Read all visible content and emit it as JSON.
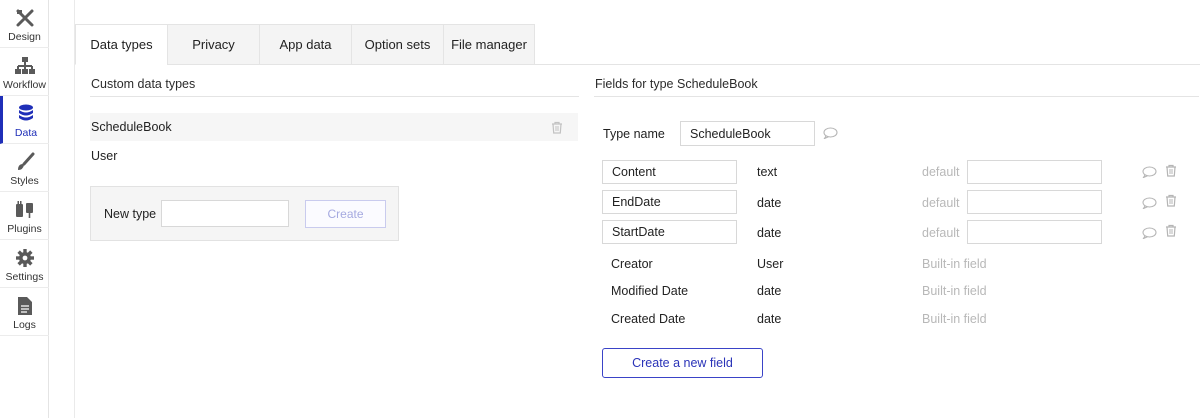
{
  "rail": {
    "items": [
      {
        "label": "Design",
        "icon": "design-tools-icon"
      },
      {
        "label": "Workflow",
        "icon": "workflow-icon"
      },
      {
        "label": "Data",
        "icon": "database-icon"
      },
      {
        "label": "Styles",
        "icon": "brush-icon"
      },
      {
        "label": "Plugins",
        "icon": "plug-icon"
      },
      {
        "label": "Settings",
        "icon": "gear-icon"
      },
      {
        "label": "Logs",
        "icon": "document-icon"
      }
    ],
    "active": "Data"
  },
  "tabs": [
    {
      "label": "Data types"
    },
    {
      "label": "Privacy"
    },
    {
      "label": "App data"
    },
    {
      "label": "Option sets"
    },
    {
      "label": "File manager"
    }
  ],
  "custom_types": {
    "title": "Custom data types",
    "items": [
      {
        "name": "ScheduleBook"
      },
      {
        "name": "User"
      }
    ],
    "new_type_label": "New type",
    "new_type_value": "",
    "create_label": "Create"
  },
  "fields_panel": {
    "title": "Fields for type ScheduleBook",
    "type_name_label": "Type name",
    "type_name_value": "ScheduleBook",
    "default_label": "default",
    "editable_fields": [
      {
        "name": "Content",
        "type": "text"
      },
      {
        "name": "EndDate",
        "type": "date"
      },
      {
        "name": "StartDate",
        "type": "date"
      }
    ],
    "builtin_fields": [
      {
        "name": "Creator",
        "type": "User",
        "note": "Built-in field"
      },
      {
        "name": "Modified Date",
        "type": "date",
        "note": "Built-in field"
      },
      {
        "name": "Created Date",
        "type": "date",
        "note": "Built-in field"
      }
    ],
    "create_field_label": "Create a new field"
  },
  "colors": {
    "accent": "#1f2fb8",
    "muted_text": "#b8b8b8",
    "border": "#d8d8d8"
  }
}
